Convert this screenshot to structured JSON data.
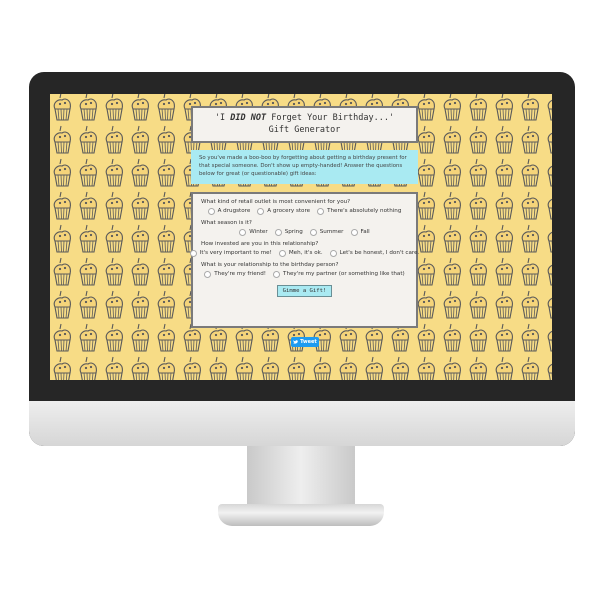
{
  "title": {
    "prefix": "'I ",
    "emphasis": "DID NOT",
    "suffix": " Forget Your Birthday...'",
    "line2": "Gift Generator"
  },
  "intro": "So you've made a boo-boo by forgetting about getting a birthday present for that special someone. Don't show up empty-handed! Answer the questions below for great (or questionable) gift ideas:",
  "questions": [
    {
      "text": "What kind of retail outlet is most convenient for you?",
      "options": [
        "A drugstore",
        "A grocery store",
        "There's absolutely nothing"
      ]
    },
    {
      "text": "What season is it?",
      "options": [
        "Winter",
        "Spring",
        "Summer",
        "Fall"
      ]
    },
    {
      "text": "How invested are you in this relationship?",
      "options": [
        "It's very important to me!",
        "Meh, it's ok.",
        "Let's be honest, I don't care."
      ]
    },
    {
      "text": "What is your relationship to the birthday person?",
      "options": [
        "They're my friend!",
        "They're my partner (or something like that)"
      ]
    }
  ],
  "button_label": "Gimme a Gift!",
  "tweet_label": "Tweet",
  "colors": {
    "background": "#f7dc86",
    "cupcake_outline": "#5a5a5a",
    "intro_box": "#a9eaf2",
    "bezel": "#262626",
    "tweet_button": "#1d9bf0"
  }
}
